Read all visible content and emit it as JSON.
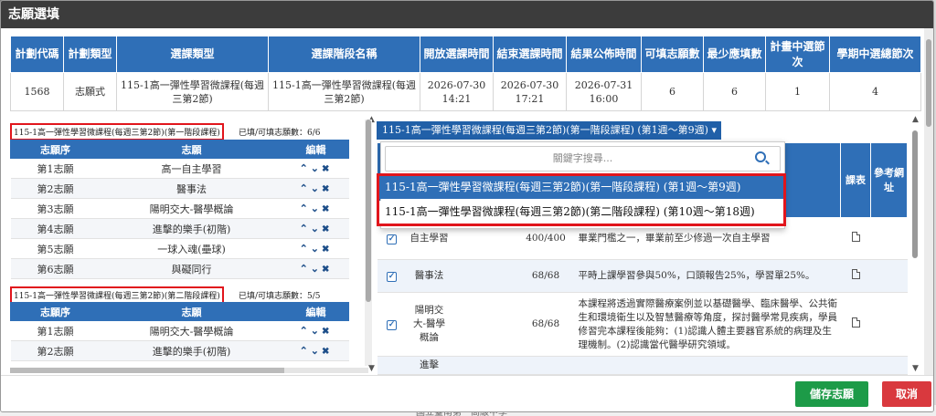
{
  "title": "志願選填",
  "plan_table": {
    "headers": [
      "計劃代碼",
      "計劃類型",
      "選課類型",
      "選課階段名稱",
      "開放選課時間",
      "結束選課時間",
      "結果公佈時間",
      "可填志願數",
      "最少應填數",
      "計畫中選節次",
      "學期中選總節次"
    ],
    "row": [
      "1568",
      "志願式",
      "115-1高一彈性學習微課程(每週三第2節)",
      "115-1高一彈性學習微課程(每週三第2節)",
      "2026-07-30\n14:21",
      "2026-07-30\n17:21",
      "2026-07-31\n16:00",
      "6",
      "6",
      "1",
      "4"
    ]
  },
  "stage1": {
    "label": "115-1高一彈性學習微課程(每週三第2節)(第一階段課程)",
    "count": "已填/可填志願數：6/6",
    "headers": [
      "志願序",
      "志願",
      "編輯"
    ],
    "rows": [
      [
        "第1志願",
        "高一自主學習"
      ],
      [
        "第2志願",
        "醫事法"
      ],
      [
        "第3志願",
        "陽明交大-醫學概論"
      ],
      [
        "第4志願",
        "進擊的樂手(初階)"
      ],
      [
        "第5志願",
        "一球入魂(壘球)"
      ],
      [
        "第6志願",
        "與礙同行"
      ]
    ]
  },
  "stage2": {
    "label": "115-1高一彈性學習微課程(每週三第2節)(第二階段課程)",
    "count": "已填/可填志願數：5/5",
    "headers": [
      "志願序",
      "志願",
      "編輯"
    ],
    "rows": [
      [
        "第1志願",
        "陽明交大-醫學概論"
      ],
      [
        "第2志願",
        "進擊的樂手(初階)"
      ]
    ]
  },
  "stage_select": {
    "value": "115-1高一彈性學習微課程(每週三第2節)(第一階段課程) (第1週～第9週)",
    "search_placeholder": "關鍵字搜尋...",
    "options": [
      "115-1高一彈性學習微課程(每週三第2節)(第一階段課程) (第1週～第9週)",
      "115-1高一彈性學習微課程(每週三第2節)(第二階段課程) (第10週～第18週)"
    ]
  },
  "course_table": {
    "headers": [
      "",
      "",
      "",
      "",
      "",
      "",
      "課表",
      "參考網址"
    ],
    "rows": [
      {
        "name": "自主學習",
        "seats": "400/400",
        "desc": "畢業門檻之一，畢業前至少修過一次自主學習"
      },
      {
        "name": "醫事法",
        "seats": "68/68",
        "desc": "平時上課學習參與50%，口頭報告25%，學習單25%。"
      },
      {
        "name": "陽明交大-醫學概論",
        "seats": "68/68",
        "desc": "本課程將透過實際醫療案例並以基礎醫學、臨床醫學、公共衛生和環境衛生以及智慧醫療等角度，探討醫學常見疾病，學員修習完本課程後能夠：(1)認識人體主要器官系統的病理及生理機制。(2)認識當代醫學研究領域。"
      },
      {
        "name": "進擊",
        "seats": "",
        "desc": ""
      }
    ]
  },
  "buttons": {
    "save": "儲存志願",
    "cancel": "取消"
  },
  "edit_glyphs": {
    "up": "⌃",
    "down": "⌄",
    "del": "✖"
  },
  "bg_text": "國立臺南第一高級中學"
}
